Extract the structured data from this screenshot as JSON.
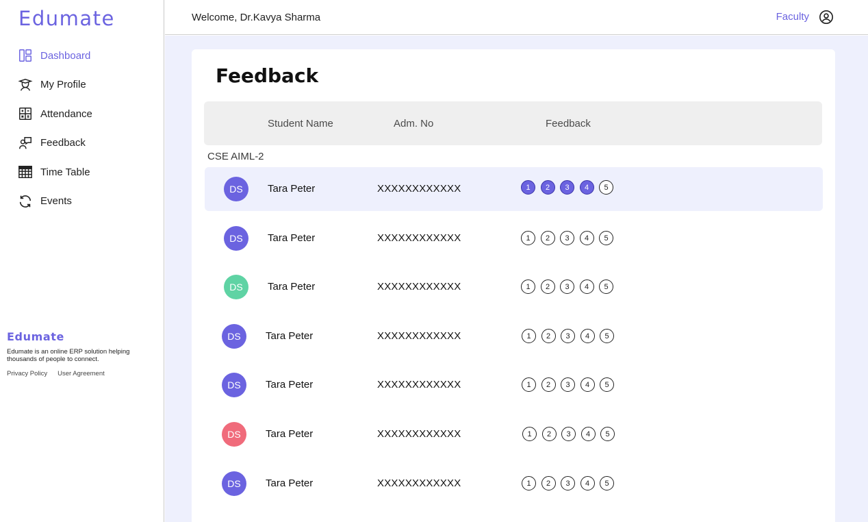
{
  "app": {
    "brand": "Edumate"
  },
  "sidebar": {
    "items": [
      {
        "label": "Dashboard",
        "icon": "dashboard-icon"
      },
      {
        "label": "My Profile",
        "icon": "graduate-icon"
      },
      {
        "label": "Attendance",
        "icon": "calculator-icon"
      },
      {
        "label": "Feedback",
        "icon": "feedback-icon"
      },
      {
        "label": "Time Table",
        "icon": "table-icon"
      },
      {
        "label": "Events",
        "icon": "refresh-icon"
      }
    ],
    "footer": {
      "brand": "Edumate",
      "text": "Edumate is an online ERP solution helping thousands of people to connect.",
      "privacy": "Privacy Policy",
      "agreement": "User Agreement"
    }
  },
  "header": {
    "welcome": "Welcome, Dr.Kavya Sharma",
    "role": "Faculty"
  },
  "main": {
    "title": "Feedback",
    "columns": {
      "name": "Student Name",
      "adm": "Adm. No",
      "feedback": "Feedback"
    },
    "section": "CSE AIML-2",
    "rating_labels": [
      "1",
      "2",
      "3",
      "4",
      "5"
    ],
    "rows": [
      {
        "initials": "DS",
        "name": "Tara Peter",
        "adm": "XXXXXXXXXXXX",
        "color": "#6b63e0",
        "rating": 4
      },
      {
        "initials": "DS",
        "name": "Tara Peter",
        "adm": "XXXXXXXXXXXX",
        "color": "#6b63e0",
        "rating": 0
      },
      {
        "initials": "DS",
        "name": "Tara Peter",
        "adm": "XXXXXXXXXXXX",
        "color": "#5fd3a4",
        "rating": 0
      },
      {
        "initials": "DS",
        "name": "Tara Peter",
        "adm": "XXXXXXXXXXXX",
        "color": "#6b63e0",
        "rating": 0
      },
      {
        "initials": "DS",
        "name": "Tara Peter",
        "adm": "XXXXXXXXXXXX",
        "color": "#6b63e0",
        "rating": 0
      },
      {
        "initials": "DS",
        "name": "Tara Peter",
        "adm": "XXXXXXXXXXXX",
        "color": "#f06b7b",
        "rating": 0
      },
      {
        "initials": "DS",
        "name": "Tara Peter",
        "adm": "XXXXXXXXXXXX",
        "color": "#6b63e0",
        "rating": 0
      }
    ]
  }
}
